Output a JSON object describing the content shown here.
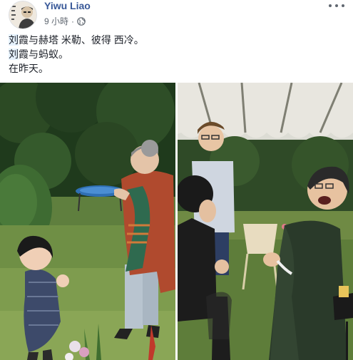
{
  "post": {
    "author": "Yiwu Liao",
    "time": "9 小時",
    "separator": "·",
    "audience_icon": "globe-icon",
    "more_icon": "more-options-icon",
    "lines": [
      {
        "pre": "",
        "hl": "刘",
        "post": "霞与赫塔 米勒、彼得 西冷。"
      },
      {
        "pre": "",
        "hl": "刘",
        "post": "霞与蚂蚁。"
      },
      {
        "pre": "在昨天。",
        "hl": "",
        "post": ""
      }
    ]
  },
  "photos": [
    {
      "name": "photo-garden-child"
    },
    {
      "name": "photo-tent-laughing"
    }
  ],
  "colors": {
    "link": "#385898",
    "meta": "#606770",
    "highlight": "#e7f3ff"
  }
}
